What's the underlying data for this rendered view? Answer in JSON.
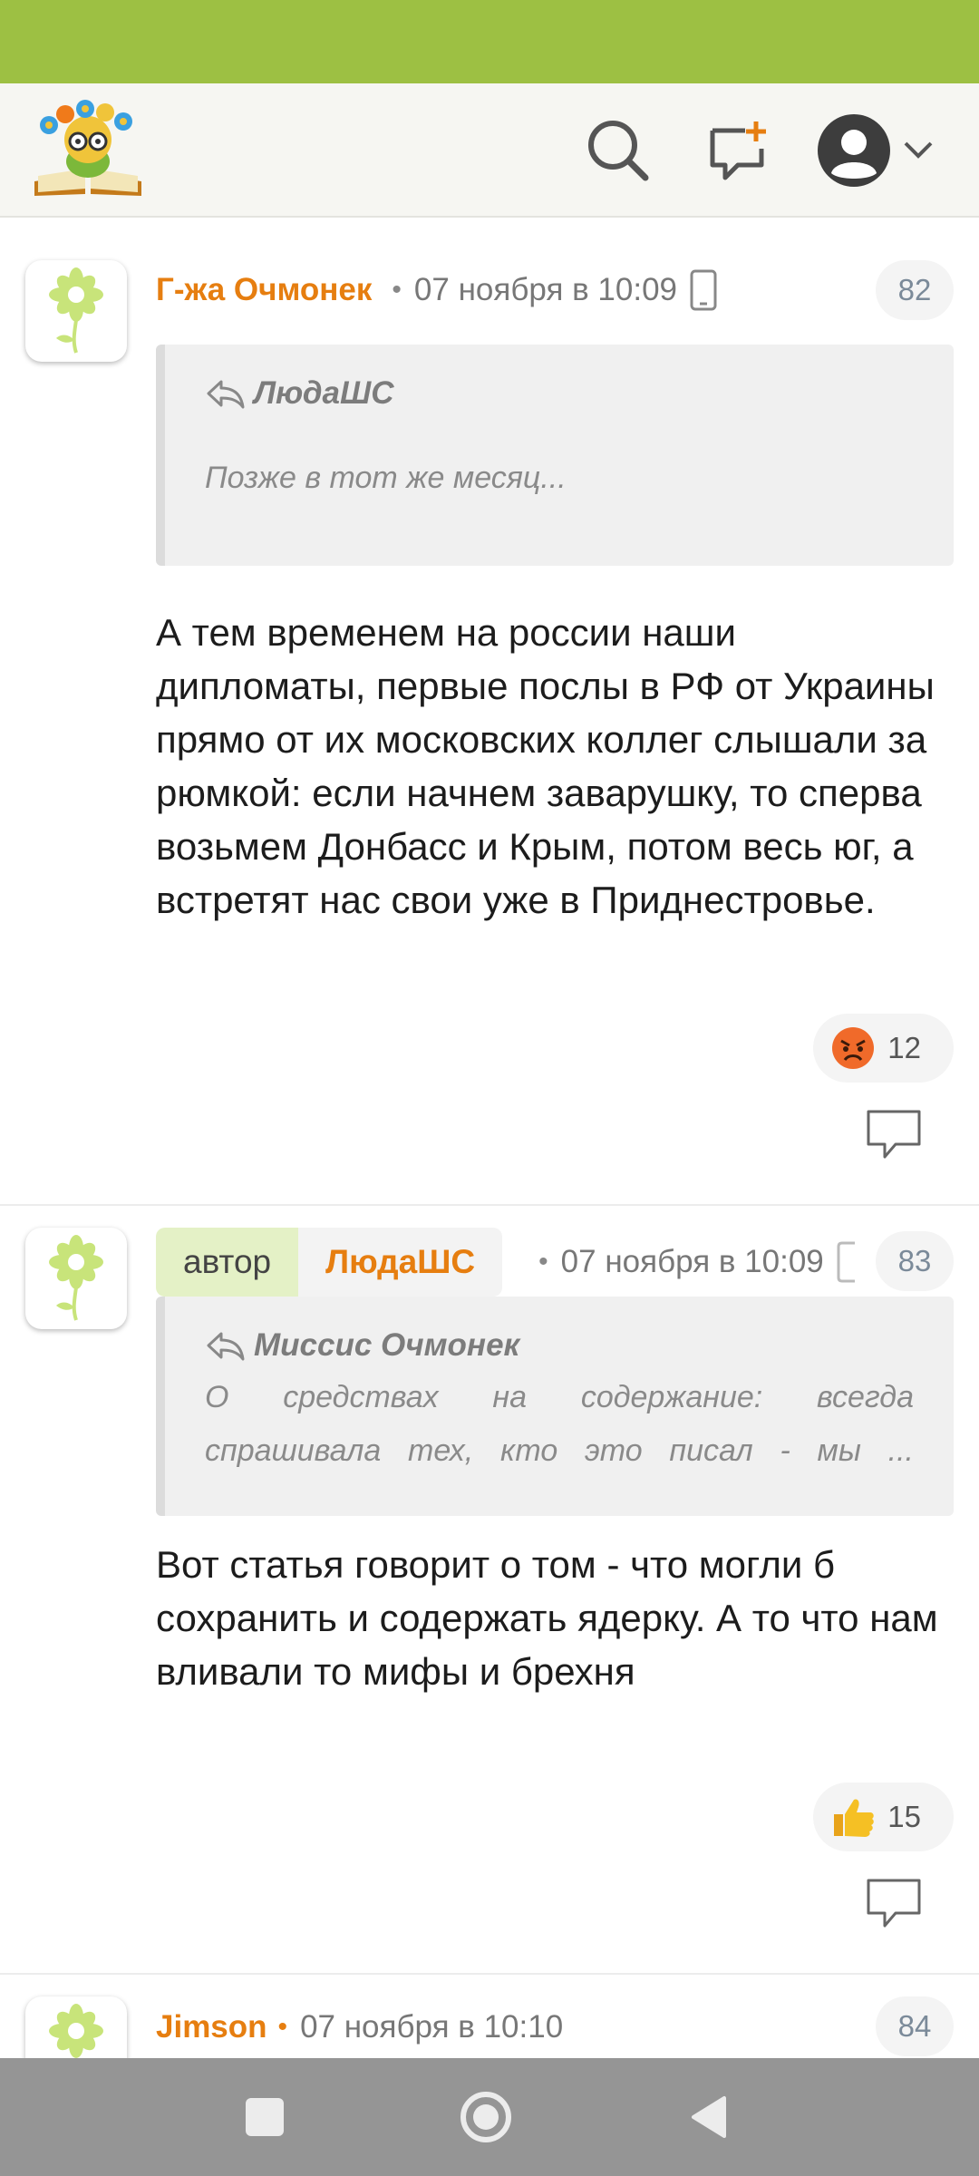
{
  "header": {
    "logo_icon": "book-flower-logo-icon",
    "search_icon": "search-icon",
    "new_message_icon": "chat-plus-icon",
    "profile_icon": "user-avatar-icon",
    "dropdown_icon": "chevron-down-icon"
  },
  "comments": [
    {
      "author": "Г-жа Очмонек",
      "separator": "•",
      "date": "07 ноября в 10:09",
      "device_icon": "phone-icon",
      "number": "82",
      "quote": {
        "author": "ЛюдаШС",
        "text": "Позже в тот же месяц..."
      },
      "text": "А тем временем на россии наши дипломаты, первые послы в РФ от Украины прямо от их московских коллег слышали за рюмкой: если начнем заварушку, то сперва возьмем Донбасс и Крым, потом весь юг, а встретят нас свои уже в Приднестровье.",
      "reaction": {
        "emoji": "angry-face-icon",
        "count": "12"
      }
    },
    {
      "author_tag": "автор",
      "author": "ЛюдаШС",
      "separator": "•",
      "date": "07 ноября в 10:09",
      "device_icon": "phone-icon",
      "number": "83",
      "quote": {
        "author": "Миссис Очмонек",
        "text": "О средствах на содержание: всегда спрашивала тех, кто это писал - мы ..."
      },
      "text": "Вот статья говорит о том - что могли б сохранить и содержать ядерку. А то что нам вливали то мифы и брехня",
      "reaction": {
        "emoji": "thumbs-up-icon",
        "count": "15"
      }
    },
    {
      "author": "Jimson",
      "separator": "•",
      "date": "07 ноября в 10:10",
      "number": "84"
    }
  ],
  "colors": {
    "status_bar": "#9dc043",
    "accent_orange": "#e67e10",
    "author_tag_bg": "#e4f1c6"
  },
  "navigation": {
    "recents_icon": "square-icon",
    "home_icon": "circle-home-icon",
    "back_icon": "triangle-back-icon"
  }
}
